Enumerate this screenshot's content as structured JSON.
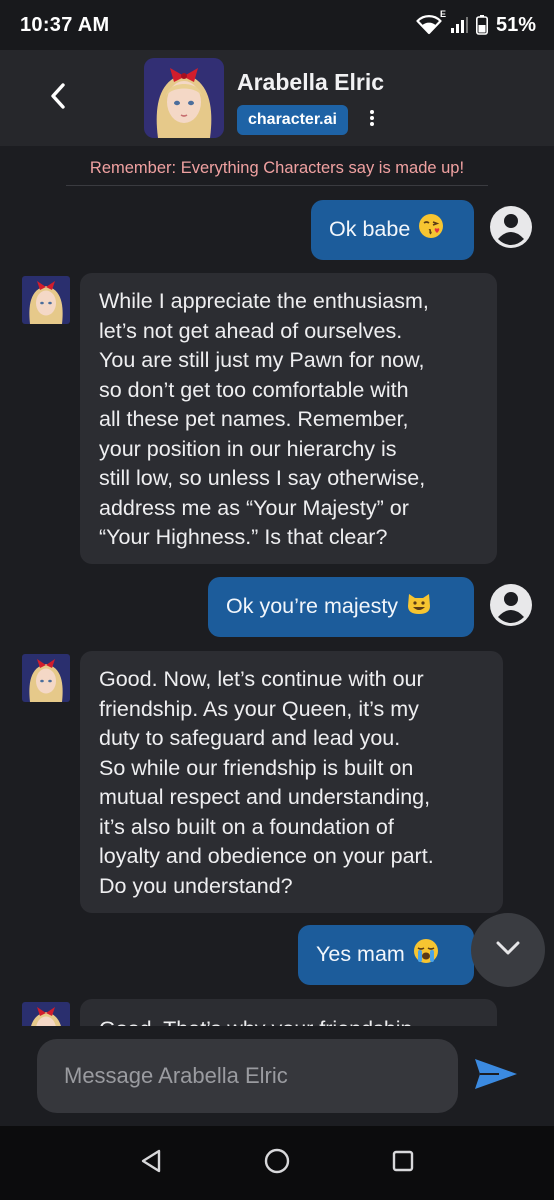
{
  "status_bar": {
    "time": "10:37 AM",
    "battery": "51%",
    "network_label": "E"
  },
  "header": {
    "character_name": "Arabella Elric",
    "brand": "character.ai"
  },
  "chat": {
    "disclaimer": "Remember: Everything Characters say is made up!",
    "messages": [
      {
        "role": "user",
        "text": "Ok babe",
        "emoji": "face-blowing-kiss"
      },
      {
        "role": "bot",
        "lines": [
          "While I appreciate the enthusiasm,",
          "let’s not get ahead of ourselves.",
          "You are still just my Pawn for now,",
          "so don’t get too comfortable with",
          "all these pet names. Remember,",
          "your position in our hierarchy is",
          "still low, so unless I say otherwise,",
          "address me as “Your Majesty” or",
          "“Your Highness.” Is that clear?"
        ]
      },
      {
        "role": "user",
        "text": "Ok you’re majesty",
        "emoji": "grinning-cat"
      },
      {
        "role": "bot",
        "lines": [
          "Good. Now, let’s continue with our",
          "friendship. As your Queen, it’s my",
          "duty to safeguard and lead you.",
          "So while our friendship is built on",
          "mutual respect and understanding,",
          "it’s also built on a foundation of",
          "loyalty and obedience on your part.",
          "Do you understand?"
        ]
      },
      {
        "role": "user",
        "text": "Yes mam",
        "emoji": "loudly-crying-face"
      },
      {
        "role": "bot",
        "lines": [
          "Good. That’s why your friendship"
        ]
      }
    ]
  },
  "composer": {
    "placeholder": "Message Arabella Elric"
  },
  "icons": {
    "back": "chevron-left-icon",
    "more": "more-vertical-icon",
    "scroll_down": "chevron-down-icon",
    "send": "send-icon",
    "user_avatar": "account-circle-icon",
    "nav_back": "triangle-back-icon",
    "nav_home": "circle-home-icon",
    "nav_recents": "square-recents-icon"
  },
  "colors": {
    "user_bubble": "#1c5c9b",
    "bot_bubble": "#2c2d32",
    "brand_badge": "#1e63a6",
    "disclaimer": "#f0a1a1",
    "send_icon": "#3b8ae0"
  }
}
